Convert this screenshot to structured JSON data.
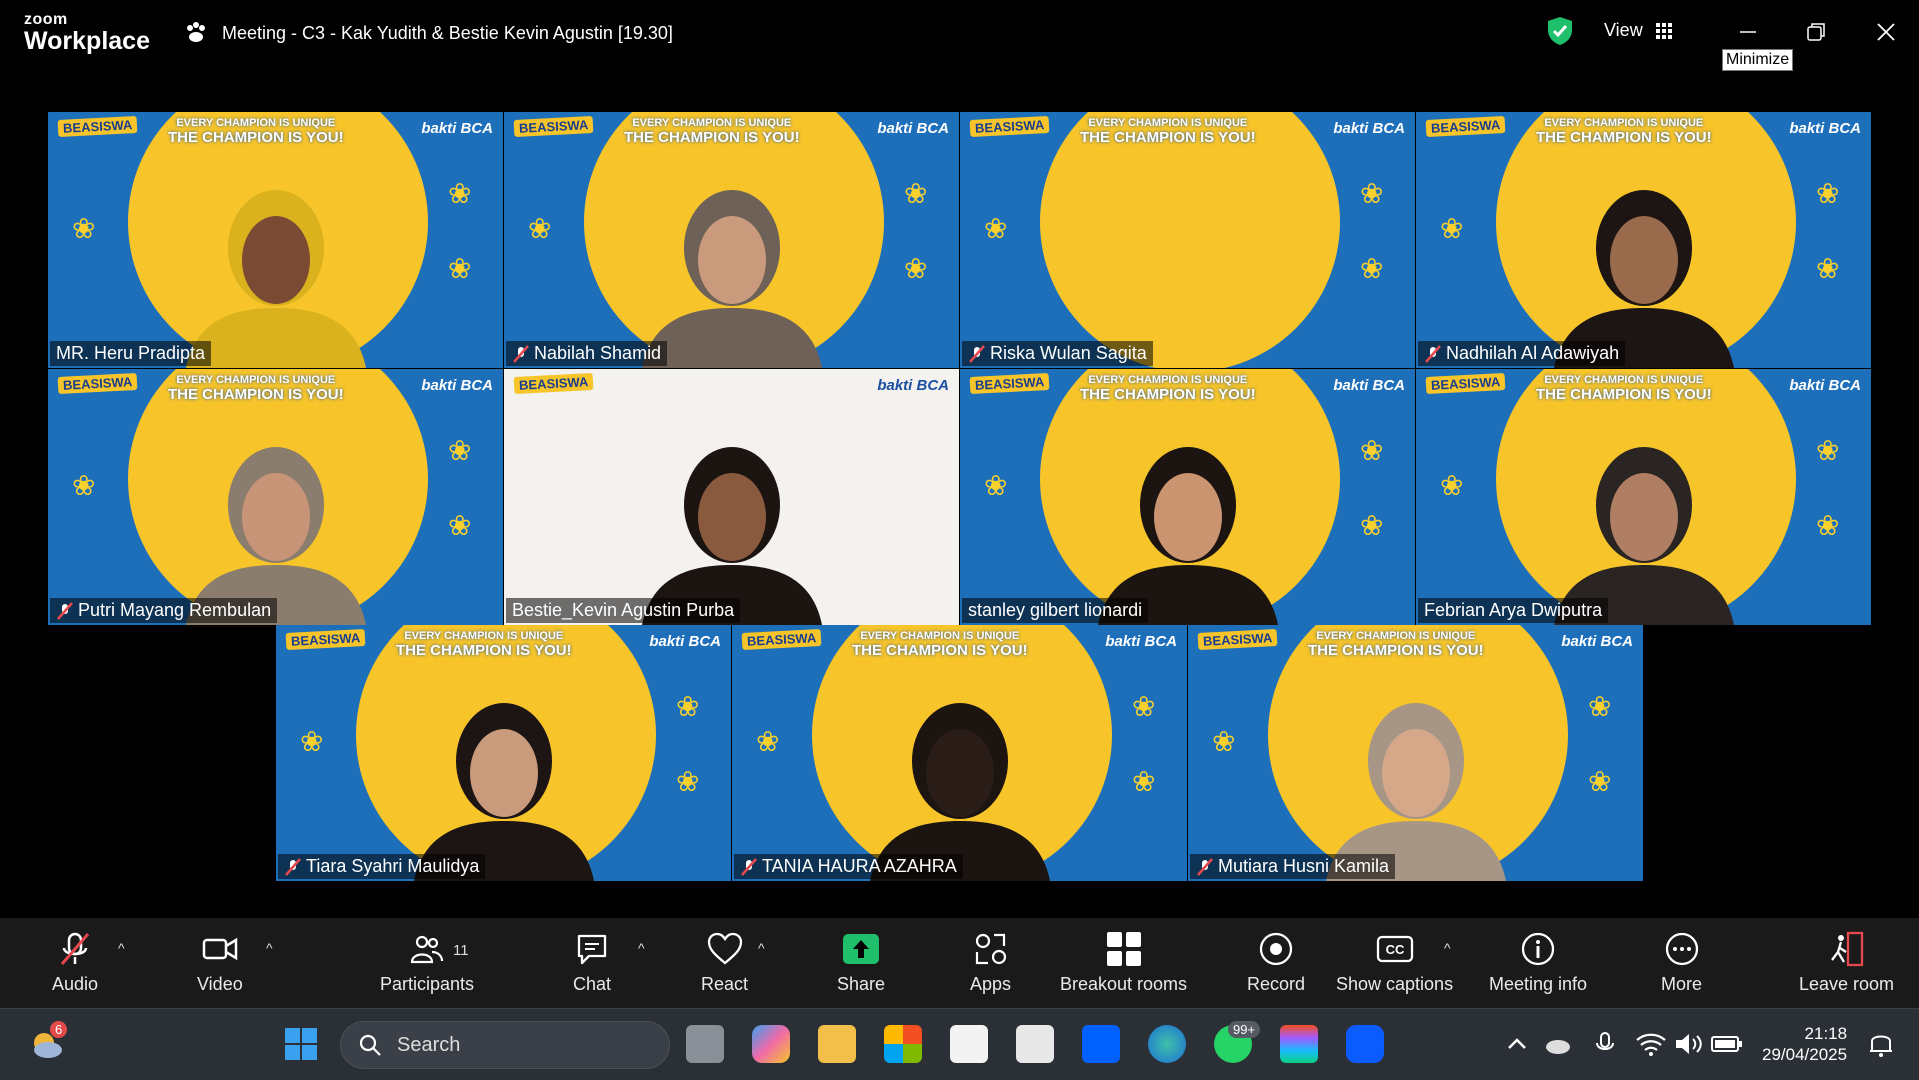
{
  "window": {
    "brand_top": "zoom",
    "brand_bottom": "Workplace",
    "meeting_title": "Meeting - C3 - Kak Yudith & Bestie Kevin Agustin [19.30]",
    "view_label": "View",
    "tooltip": "Minimize"
  },
  "tile_branding": {
    "logo_left": "BEASISWA",
    "logo_right": "bakti BCA",
    "banner_line1": "EVERY CHAMPION IS UNIQUE",
    "banner_line2": "THE CHAMPION IS YOU!"
  },
  "participants": [
    {
      "name": "MR. Heru Pradipta",
      "muted": false
    },
    {
      "name": "Nabilah Shamid",
      "muted": true
    },
    {
      "name": "Riska Wulan Sagita",
      "muted": true
    },
    {
      "name": "Nadhilah Al Adawiyah",
      "muted": true
    },
    {
      "name": "Putri Mayang Rembulan",
      "muted": true
    },
    {
      "name": "Bestie_Kevin Agustin Purba",
      "muted": false,
      "active_speaker": true
    },
    {
      "name": "stanley gilbert lionardi",
      "muted": false
    },
    {
      "name": "Febrian Arya Dwiputra",
      "muted": false
    },
    {
      "name": "Tiara Syahri Maulidya",
      "muted": true
    },
    {
      "name": "TANIA HAURA AZAHRA",
      "muted": true
    },
    {
      "name": "Mutiara Husni Kamila",
      "muted": true
    }
  ],
  "toolbar": {
    "audio": "Audio",
    "video": "Video",
    "participants": "Participants",
    "participants_count": "11",
    "chat": "Chat",
    "react": "React",
    "share": "Share",
    "apps": "Apps",
    "breakout": "Breakout rooms",
    "record": "Record",
    "captions": "Show captions",
    "info": "Meeting info",
    "more": "More",
    "leave": "Leave room"
  },
  "taskbar": {
    "weather_badge": "6",
    "search_placeholder": "Search",
    "whatsapp_badge": "99+",
    "time": "21:18",
    "date": "29/04/2025"
  },
  "colors": {
    "active_speaker_border": "#22d17a",
    "share_button": "#1fbf6b",
    "tile_blue": "#1d6fb9",
    "tile_sun": "#f7c52a"
  }
}
